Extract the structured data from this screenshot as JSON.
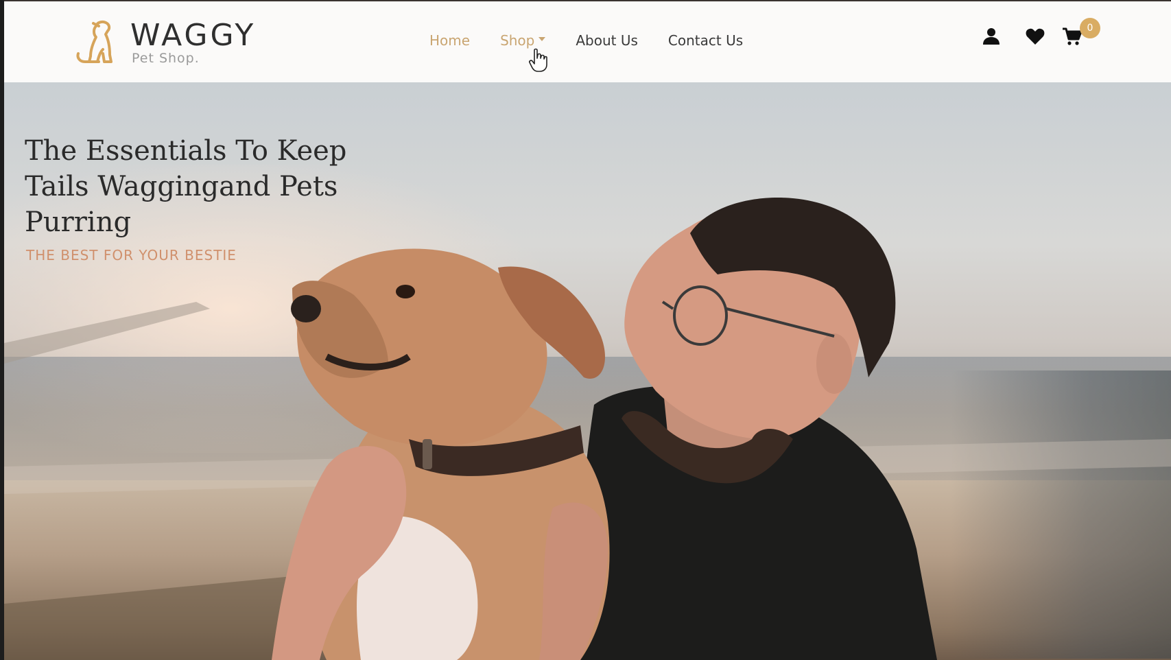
{
  "brand": {
    "name": "WAGGY",
    "tagline": "Pet Shop."
  },
  "nav": {
    "items": [
      {
        "label": "Home",
        "state": "active"
      },
      {
        "label": "Shop",
        "has_dropdown": true
      },
      {
        "label": "About Us"
      },
      {
        "label": "Contact Us"
      }
    ]
  },
  "header_icons": {
    "user": "user-icon",
    "wishlist": "heart-icon",
    "cart": "cart-icon",
    "cart_count": "0"
  },
  "hero": {
    "title": "The Essentials To Keep Tails Waggingand Pets Purring",
    "subtitle": "THE BEST FOR YOUR BESTIE"
  },
  "colors": {
    "accent": "#c9a571",
    "badge": "#d9ac63",
    "subtitle": "#d0906c",
    "text": "#2f2f2f"
  }
}
